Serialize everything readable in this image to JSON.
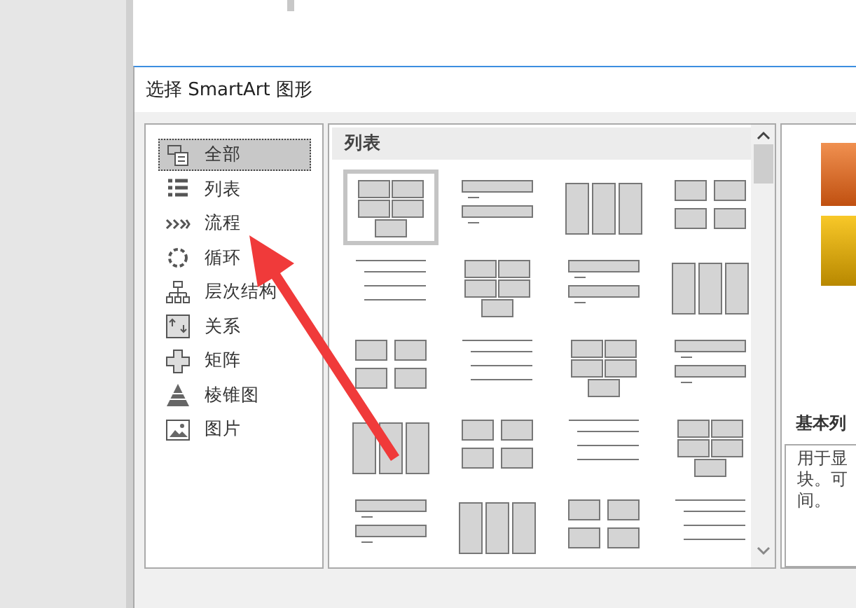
{
  "dialog": {
    "title": "选择 SmartArt 图形"
  },
  "categories": [
    {
      "label": "全部",
      "selected": true
    },
    {
      "label": "列表",
      "selected": false
    },
    {
      "label": "流程",
      "selected": false
    },
    {
      "label": "循环",
      "selected": false
    },
    {
      "label": "层次结构",
      "selected": false
    },
    {
      "label": "关系",
      "selected": false
    },
    {
      "label": "矩阵",
      "selected": false
    },
    {
      "label": "棱锥图",
      "selected": false
    },
    {
      "label": "图片",
      "selected": false
    }
  ],
  "gallery": {
    "heading": "列表",
    "items": [
      {
        "selected": true
      },
      {
        "selected": false
      },
      {
        "selected": false
      },
      {
        "selected": false
      },
      {
        "selected": false
      },
      {
        "selected": false
      },
      {
        "selected": false
      },
      {
        "selected": false
      },
      {
        "selected": false
      },
      {
        "selected": false
      },
      {
        "selected": false
      },
      {
        "selected": false
      },
      {
        "selected": false
      },
      {
        "selected": false
      },
      {
        "selected": false
      },
      {
        "selected": false
      },
      {
        "selected": false
      },
      {
        "selected": false
      },
      {
        "selected": false
      },
      {
        "selected": false
      }
    ]
  },
  "preview": {
    "title": "基本列",
    "description_lines": [
      "用于显",
      "块。可",
      "间。"
    ]
  }
}
